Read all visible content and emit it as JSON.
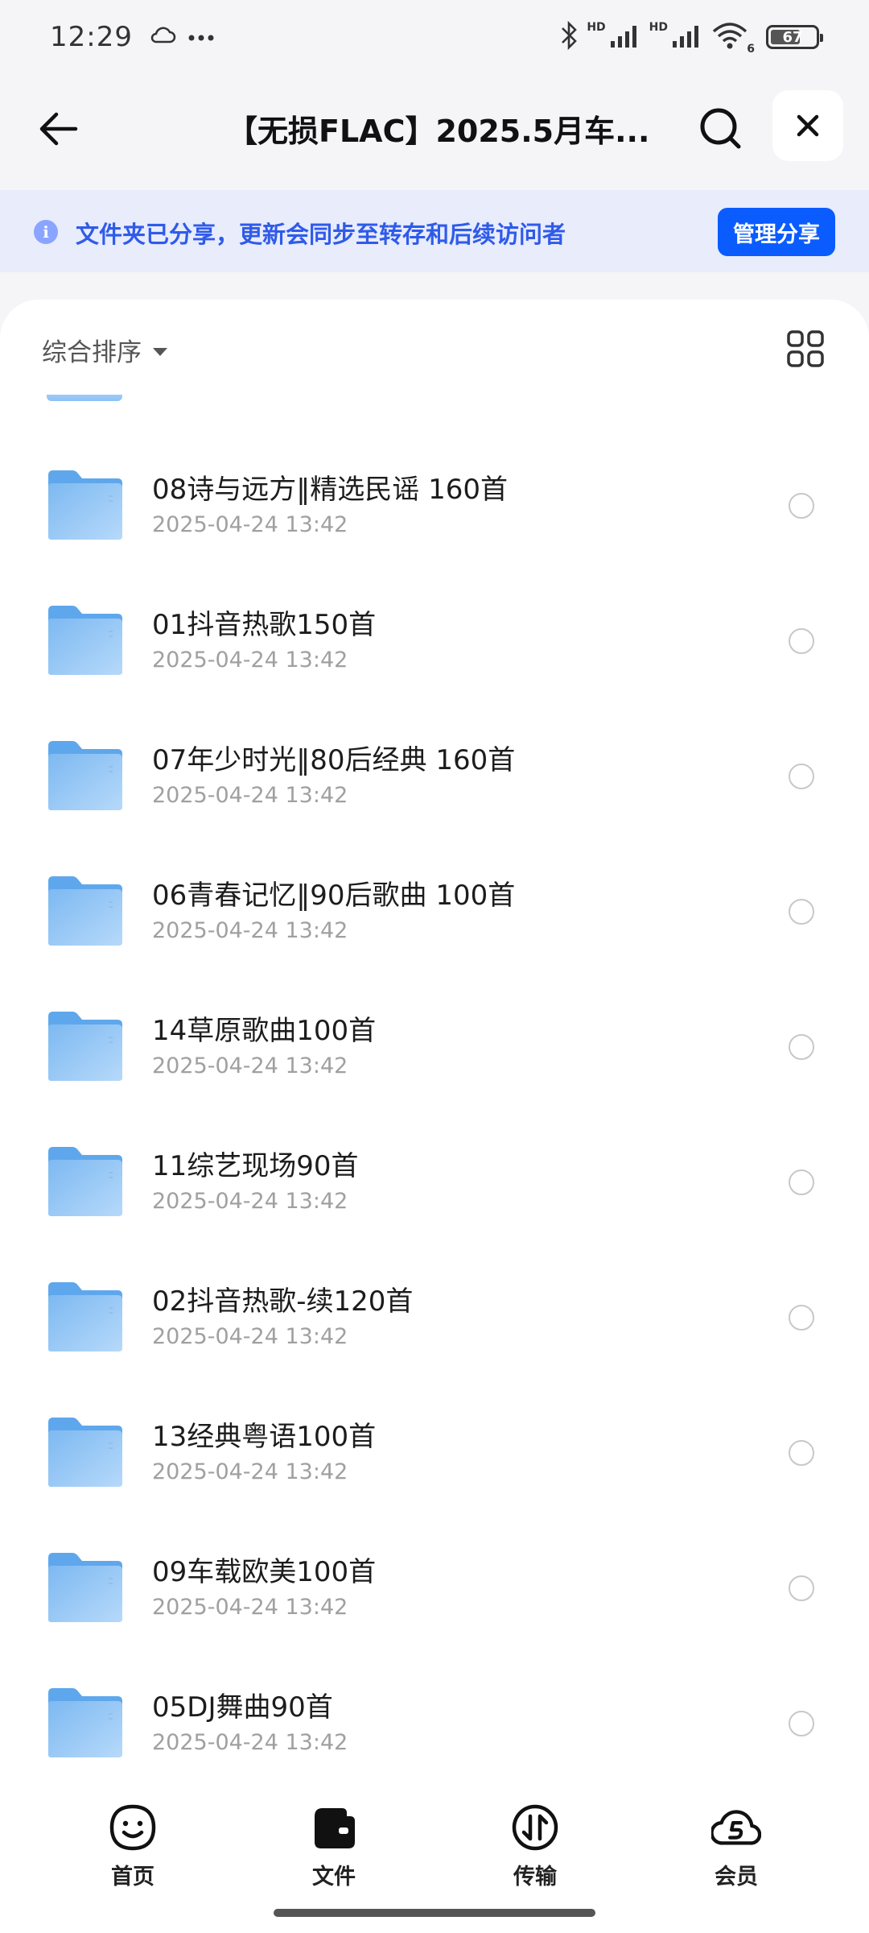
{
  "status_bar": {
    "time": "12:29",
    "battery_level": "67",
    "network_tags": [
      "HD",
      "HD"
    ],
    "wifi_sub": "6",
    "icons": [
      "cloud-icon",
      "more-dots-icon",
      "bluetooth-icon",
      "signal-icon",
      "signal-icon",
      "wifi-icon",
      "battery-icon"
    ]
  },
  "header": {
    "title": "【无损FLAC】2025.5月车...",
    "back_icon": "back-arrow-icon",
    "search_icon": "search-icon",
    "close_icon": "close-icon"
  },
  "share_banner": {
    "text": "文件夹已分享，更新会同步至转存和后续访问者",
    "button_label": "管理分享",
    "accent": "#2f5bea",
    "button_color": "#0a5cff"
  },
  "toolbar": {
    "sort_label": "综合排序",
    "view_icon": "grid-view-icon"
  },
  "files": [
    {
      "name": "08诗与远方‖精选民谣 160首",
      "date": "2025-04-24 13:42"
    },
    {
      "name": "01抖音热歌150首",
      "date": "2025-04-24 13:42"
    },
    {
      "name": "07年少时光‖80后经典 160首",
      "date": "2025-04-24 13:42"
    },
    {
      "name": "06青春记忆‖90后歌曲 100首",
      "date": "2025-04-24 13:42"
    },
    {
      "name": "14草原歌曲100首",
      "date": "2025-04-24 13:42"
    },
    {
      "name": "11综艺现场90首",
      "date": "2025-04-24 13:42"
    },
    {
      "name": "02抖音热歌-续120首",
      "date": "2025-04-24 13:42"
    },
    {
      "name": "13经典粤语100首",
      "date": "2025-04-24 13:42"
    },
    {
      "name": "09车载欧美100首",
      "date": "2025-04-24 13:42"
    },
    {
      "name": "05DJ舞曲90首",
      "date": "2025-04-24 13:42"
    }
  ],
  "bottom_nav": [
    {
      "label": "首页",
      "icon": "smiley-home-icon"
    },
    {
      "label": "文件",
      "icon": "wallet-file-icon"
    },
    {
      "label": "传输",
      "icon": "transfer-icon"
    },
    {
      "label": "会员",
      "icon": "cloud-member-icon"
    }
  ],
  "colors": {
    "folder": "#8cc2f4",
    "folder_dark": "#5fa7ec",
    "background": "#f5f5f7"
  }
}
